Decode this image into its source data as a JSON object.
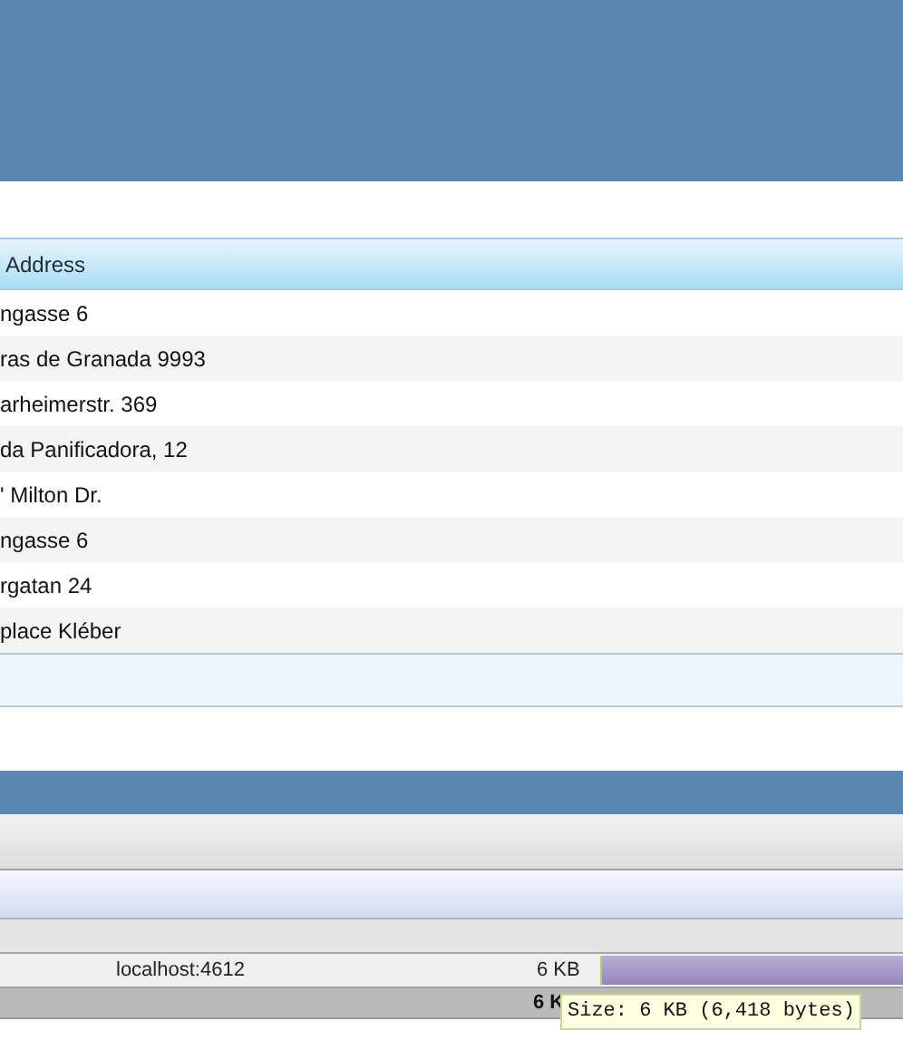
{
  "table": {
    "column_header": "Address",
    "rows": [
      {
        "address": "ngasse 6"
      },
      {
        "address": "ras de Granada 9993"
      },
      {
        "address": "arheimerstr. 369"
      },
      {
        "address": "da Panificadora, 12"
      },
      {
        "address": "' Milton Dr."
      },
      {
        "address": "ngasse 6"
      },
      {
        "address": "rgatan 24"
      },
      {
        "address": "place Kléber"
      }
    ]
  },
  "network_panel": {
    "request": {
      "domain": "localhost:4612",
      "size": "6 KB"
    },
    "summary": {
      "total_size": "6 K"
    },
    "tooltip": "Size: 6 KB (6,418 bytes)"
  }
}
